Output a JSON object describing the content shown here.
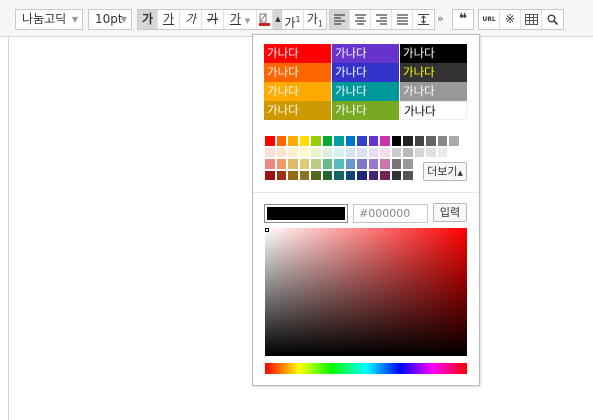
{
  "toolbar": {
    "font_family": "나눔고딕",
    "font_size": "10pt",
    "style_buttons": [
      "가",
      "가",
      "가",
      "가",
      "가"
    ],
    "superscript": "가",
    "subscript": "가",
    "superscript_mark": "1",
    "subscript_mark": "1",
    "more": "»",
    "quote": "❝",
    "url": "URL",
    "special_char": "※",
    "table_icon": "table-icon",
    "search": "🔍"
  },
  "palette": {
    "presets": [
      {
        "label": "가나다",
        "bg": "#ff0000",
        "fg": "#ffffff"
      },
      {
        "label": "가나다",
        "bg": "#6633cc",
        "fg": "#ffffff"
      },
      {
        "label": "가나다",
        "bg": "#000000",
        "fg": "#ffffff"
      },
      {
        "label": "가나다",
        "bg": "#ff6600",
        "fg": "#ffffff"
      },
      {
        "label": "가나다",
        "bg": "#3333cc",
        "fg": "#ffffff"
      },
      {
        "label": "가나다",
        "bg": "#333333",
        "fg": "#ffff00"
      },
      {
        "label": "가나다",
        "bg": "#ffaa00",
        "fg": "#ffffff"
      },
      {
        "label": "가나다",
        "bg": "#009999",
        "fg": "#ffffff"
      },
      {
        "label": "가나다",
        "bg": "#999999",
        "fg": "#ffffff"
      },
      {
        "label": "가나다",
        "bg": "#cc9900",
        "fg": "#ffffff"
      },
      {
        "label": "가나다",
        "bg": "#77aa22",
        "fg": "#ffffff"
      },
      {
        "label": "가나다",
        "bg": "#ffffff",
        "fg": "#000000"
      }
    ],
    "swatches": [
      [
        "#ff0000",
        "#ff6600",
        "#ffaa00",
        "#ffdd00",
        "#99cc00",
        "#00aa33",
        "#00a0a0",
        "#0077cc",
        "#3344cc",
        "#6633cc",
        "#cc33aa",
        "#000000",
        "#222222",
        "#444444",
        "#666666",
        "#888888",
        "#aaaaaa"
      ],
      [
        "#ffdddd",
        "#ffe5cc",
        "#fff0cc",
        "#fffacc",
        "#eef5cc",
        "#ddf0dd",
        "#d5f0f0",
        "#d5e5f5",
        "#dddff5",
        "#e5ddf5",
        "#f5ddee",
        "#cccccc",
        "#bbbbbb",
        "#d5d5d5",
        "#e0e0e0",
        "#ebebeb",
        "#ffffff"
      ],
      [
        "#ee8888",
        "#ee9966",
        "#ddbb66",
        "#ddcc77",
        "#bbcc88",
        "#66bb88",
        "#55bbbb",
        "#6699cc",
        "#7777cc",
        "#9977cc",
        "#cc77aa",
        "#777777",
        "#999999",
        "#ffffff",
        "#ffffff",
        "#ffffff",
        "#ffffff"
      ],
      [
        "#991111",
        "#993311",
        "#996611",
        "#887722",
        "#556622",
        "#226633",
        "#116666",
        "#114477",
        "#222277",
        "#442277",
        "#772255",
        "#333333",
        "#555555",
        "#ffffff",
        "#ffffff",
        "#ffffff",
        "#ffffff"
      ]
    ],
    "more_label": "더보기",
    "hex_value": "#000000",
    "enter_label": "입력"
  }
}
